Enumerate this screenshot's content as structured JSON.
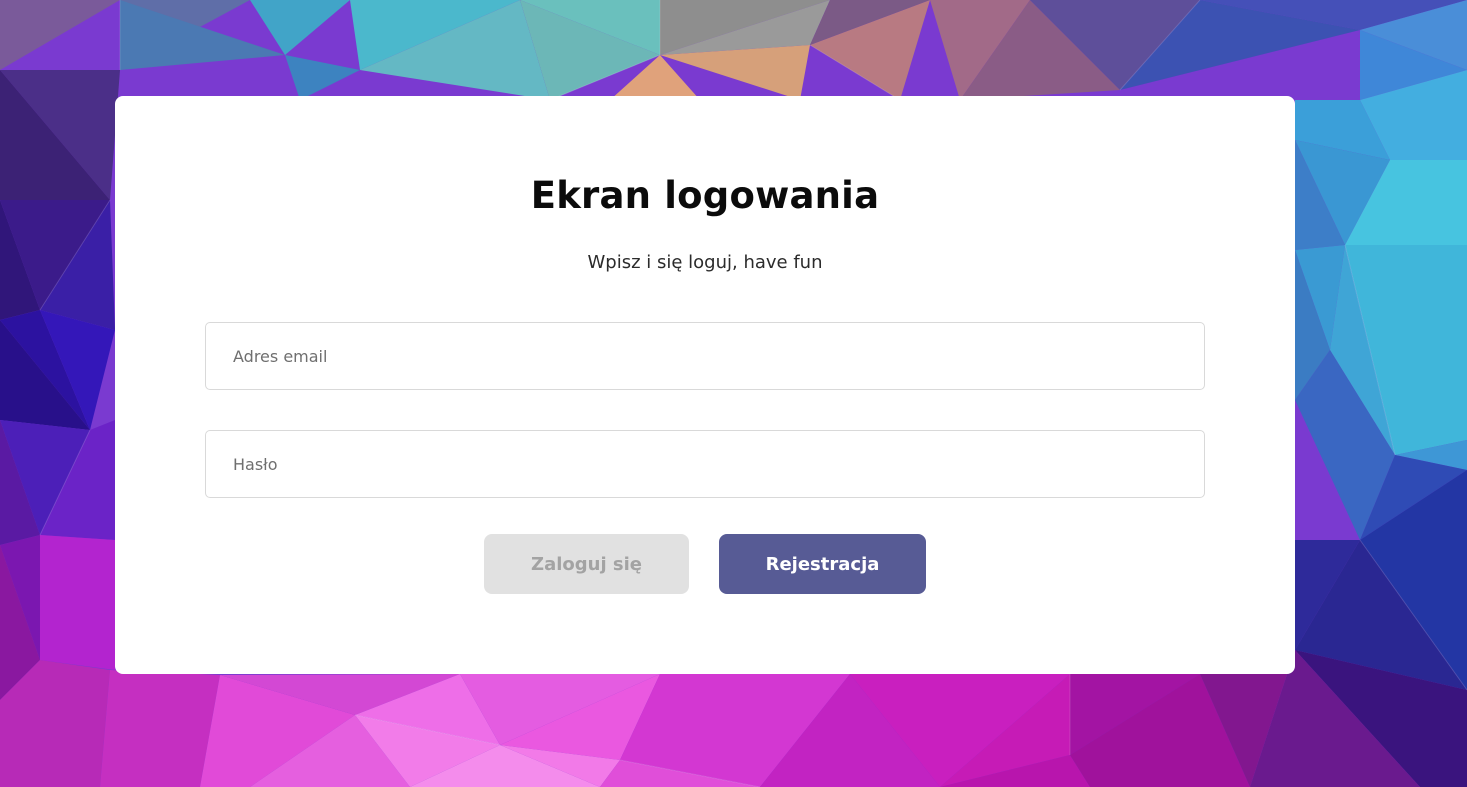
{
  "login_screen": {
    "title": "Ekran logowania",
    "subtitle": "Wpisz i się loguj, have fun",
    "email_placeholder": "Adres email",
    "password_placeholder": "Hasło",
    "login_button": "Zaloguj się",
    "register_button": "Rejestracja"
  },
  "colors": {
    "card_background": "#ffffff",
    "register_button": "#575b95",
    "login_button_disabled": "#e1e1e1",
    "login_button_text": "#a3a3a3"
  }
}
